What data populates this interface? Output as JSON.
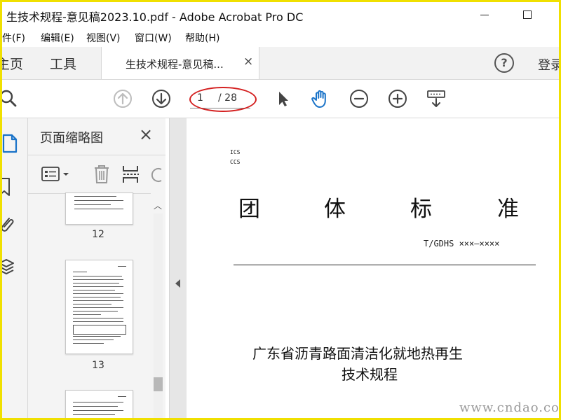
{
  "window": {
    "title": "生技术规程-意见稿2023.10.pdf - Adobe Acrobat Pro DC"
  },
  "menu": [
    "件(F)",
    "编辑(E)",
    "视图(V)",
    "窗口(W)",
    "帮助(H)"
  ],
  "tabs": {
    "home": "主页",
    "tools": "工具",
    "document": "生技术规程-意见稿...",
    "close": "×",
    "help": "?",
    "login": "登录"
  },
  "toolbar": {
    "current_page": "1",
    "total_pages": "/ 28"
  },
  "thumbnails_panel": {
    "title": "页面缩略图",
    "close": "×",
    "pages": [
      "12",
      "13"
    ]
  },
  "document": {
    "ics": "ICS",
    "ccs": "CCS",
    "heading_chars": [
      "团",
      "体",
      "标",
      "准"
    ],
    "standard_code": "T/GDHS  ×××—××××",
    "title_line1": "广东省沥青路面清洁化就地热再生",
    "title_line2": "技术规程"
  },
  "watermark": "www.cndao.com",
  "colors": {
    "frame_border": "#f0e000",
    "accent_blue": "#1a73c8",
    "annotation_red": "#d42020"
  }
}
